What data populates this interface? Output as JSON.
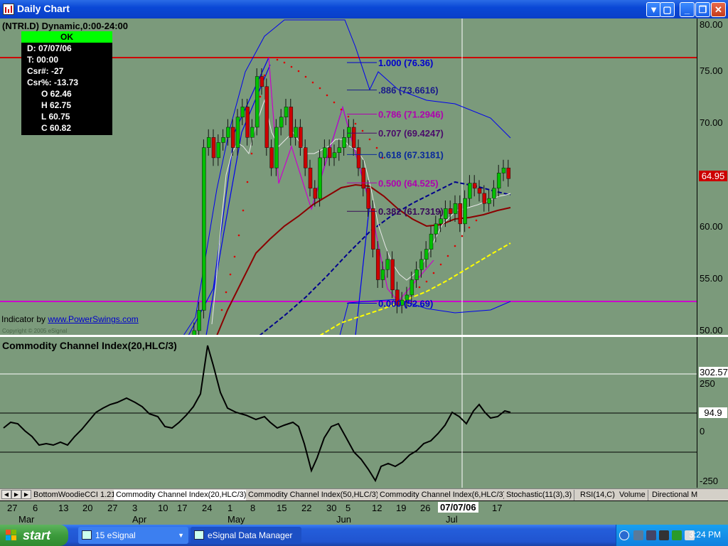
{
  "window": {
    "title": "Daily Chart",
    "buttons": {
      "dropdown": "▼",
      "restore": "❐",
      "minimize": "_",
      "max": "▢",
      "close": "✕"
    }
  },
  "price_pane": {
    "symbol_line": "(NTRI.D) Dynamic,0:00-24:00",
    "indicator_credit": "Indicator by",
    "indicator_link": "www.PowerSwings.com",
    "copyright": "Copyright © 2005 eSignal",
    "last_price": "64.95",
    "axis_labels": [
      "80.00",
      "75.00",
      "70.00",
      "65.00",
      "60.00",
      "55.00",
      "50.00"
    ],
    "info_box": {
      "header": "OK",
      "rows": [
        "D: 07/07/06",
        "T: 00:00",
        "Csr#: -27",
        "Csr%: -13.73",
        "O 62.46",
        "H 62.75",
        "L 60.75",
        "C 60.82"
      ]
    },
    "fib_levels": [
      {
        "ratio": "1.000",
        "price": "76.36",
        "value": 76.36,
        "color": "#0000cc"
      },
      {
        "ratio": ".886",
        "price": "73.6616",
        "value": 73.6616,
        "color": "#1a1a8a"
      },
      {
        "ratio": "0.786",
        "price": "71.2946",
        "value": 71.2946,
        "color": "#b000b0"
      },
      {
        "ratio": "0.707",
        "price": "69.4247",
        "value": 69.4247,
        "color": "#4a0a6a"
      },
      {
        "ratio": "0.618",
        "price": "67.3181",
        "value": 67.3181,
        "color": "#0a2a9a"
      },
      {
        "ratio": "0.500",
        "price": "64.525",
        "value": 64.525,
        "color": "#b000b0"
      },
      {
        "ratio": "0.382",
        "price": "61.7319",
        "value": 61.7319,
        "color": "#3a0a5a"
      },
      {
        "ratio": "0.000",
        "price": "52.69",
        "value": 52.69,
        "color": "#0000cc"
      }
    ]
  },
  "cci_pane": {
    "title": "Commodity Channel Index(20,HLC/3)",
    "axis_labels": [
      "302.57",
      "250",
      "94.9",
      "0",
      "-250"
    ]
  },
  "tabs": [
    {
      "label": "BottomWoodieCCI 1.21",
      "active": false
    },
    {
      "label": "Commodity Channel Index(20,HLC/3)",
      "active": true
    },
    {
      "label": "Commodity Channel Index(50,HLC/3)",
      "active": false
    },
    {
      "label": "Commodity Channel Index(6,HLC/3)",
      "active": false
    },
    {
      "label": "Stochastic(11(3),3)",
      "active": false
    },
    {
      "label": "RSI(14,C)",
      "active": false
    },
    {
      "label": "Volume",
      "active": false
    },
    {
      "label": "Directional M",
      "active": false
    }
  ],
  "date_axis": {
    "ticks": [
      "27",
      "6",
      "13",
      "20",
      "27",
      "3",
      "10",
      "17",
      "24",
      "1",
      "8",
      "15",
      "22",
      "30",
      "5",
      "12",
      "19",
      "26",
      "17"
    ],
    "cursor_date": "07/07/06",
    "months": [
      "Mar",
      "Apr",
      "May",
      "Jun",
      "Jul"
    ]
  },
  "taskbar": {
    "start_label": "start",
    "buttons": [
      {
        "label": "15 eSignal"
      },
      {
        "label": "eSignal Data Manager"
      }
    ],
    "clock": "3:24 PM"
  },
  "colors": {
    "chart_bg": "#7b9a7b",
    "up_candle": "#00c000",
    "down_candle": "#cc0000",
    "resistance": "#cc0000",
    "support": "#cc00cc",
    "bollinger": "#0000ee",
    "ma_dark_red": "#8b0000",
    "ma_navy": "#00008b",
    "ma_yellow": "#ffff00"
  }
}
